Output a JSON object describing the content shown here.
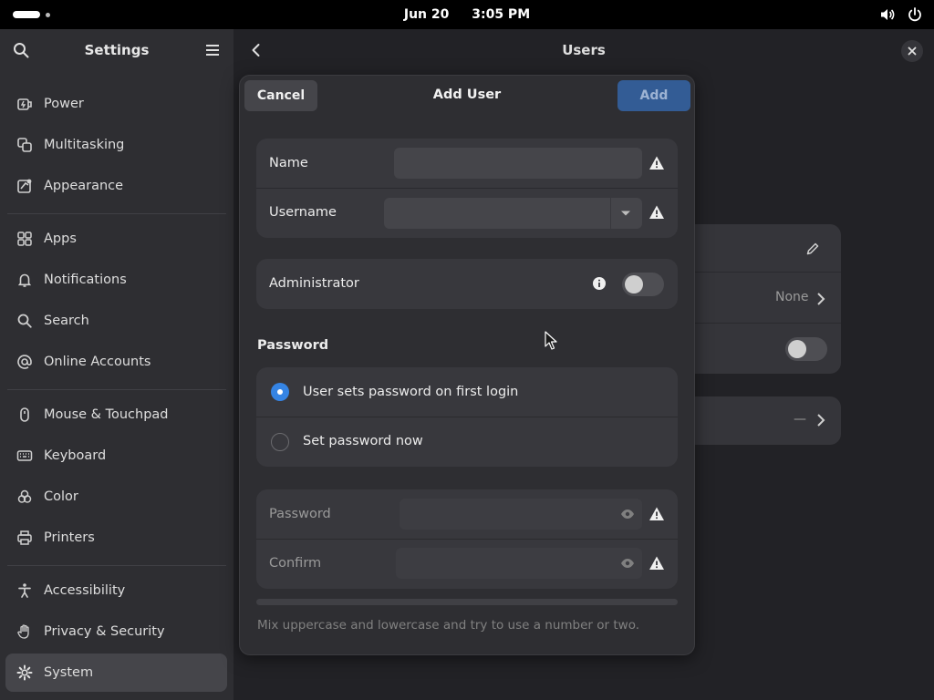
{
  "topbar": {
    "date": "Jun 20",
    "time": "3:05 PM"
  },
  "sidebar": {
    "title": "Settings",
    "items": [
      {
        "label": "Power",
        "icon": "power-icon"
      },
      {
        "label": "Multitasking",
        "icon": "multitasking-icon"
      },
      {
        "label": "Appearance",
        "icon": "appearance-icon"
      },
      {
        "label": "Apps",
        "icon": "apps-icon"
      },
      {
        "label": "Notifications",
        "icon": "bell-icon"
      },
      {
        "label": "Search",
        "icon": "search-icon"
      },
      {
        "label": "Online Accounts",
        "icon": "at-icon"
      },
      {
        "label": "Mouse & Touchpad",
        "icon": "mouse-icon"
      },
      {
        "label": "Keyboard",
        "icon": "keyboard-icon"
      },
      {
        "label": "Color",
        "icon": "color-icon"
      },
      {
        "label": "Printers",
        "icon": "printer-icon"
      },
      {
        "label": "Accessibility",
        "icon": "accessibility-icon"
      },
      {
        "label": "Privacy & Security",
        "icon": "hand-icon"
      },
      {
        "label": "System",
        "icon": "gear-icon",
        "active": true
      }
    ]
  },
  "main": {
    "title": "Users",
    "background_rows": {
      "autologin_value": "None",
      "fingerprint_value": "—"
    }
  },
  "dialog": {
    "cancel_label": "Cancel",
    "title": "Add User",
    "add_label": "Add",
    "name_label": "Name",
    "name_value": "",
    "username_label": "Username",
    "username_value": "",
    "administrator_label": "Administrator",
    "administrator_enabled": false,
    "password_heading": "Password",
    "option_first_login": "User sets password on first login",
    "option_set_now": "Set password now",
    "selected_option": "first_login",
    "password_label": "Password",
    "password_value": "",
    "confirm_label": "Confirm",
    "confirm_value": "",
    "hint": "Mix uppercase and lowercase and try to use a number or two."
  },
  "colors": {
    "accent": "#3584e4",
    "add_button": "#335c95",
    "panel": "#2e2e32",
    "card": "#38383d"
  }
}
